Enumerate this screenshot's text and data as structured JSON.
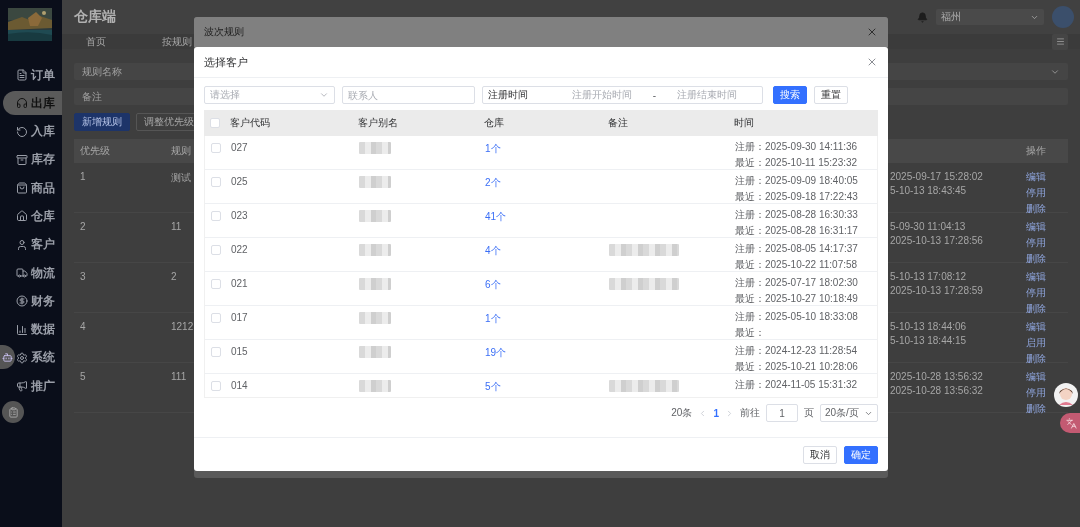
{
  "sidebar": {
    "items": [
      {
        "label": "订单",
        "selected": false
      },
      {
        "label": "出库",
        "selected": true
      },
      {
        "label": "入库",
        "selected": false
      },
      {
        "label": "库存",
        "selected": false
      },
      {
        "label": "商品",
        "selected": false
      },
      {
        "label": "仓库",
        "selected": false
      },
      {
        "label": "客户",
        "selected": false
      },
      {
        "label": "物流",
        "selected": false
      },
      {
        "label": "财务",
        "selected": false
      },
      {
        "label": "数据",
        "selected": false
      },
      {
        "label": "系统",
        "selected": false
      },
      {
        "label": "推广",
        "selected": false
      }
    ]
  },
  "header": {
    "title": "仓库端",
    "location_select": "福州"
  },
  "page_tabs": [
    {
      "label": "首页"
    },
    {
      "label": "按规则"
    }
  ],
  "rule_filters": {
    "name_placeholder": "规则名称",
    "note_placeholder": "备注"
  },
  "rule_actions": [
    {
      "label": "新增规则",
      "kind": "primary"
    },
    {
      "label": "调整优先级",
      "kind": "secondary"
    }
  ],
  "rules_table": {
    "columns": [
      "优先级",
      "规则",
      "操作"
    ],
    "rows": [
      {
        "priority": "1",
        "name": "测试",
        "time_1": "2025-09-17 15:28:02",
        "time_2": "5-10-13 18:43:45",
        "actions": [
          "编辑",
          "停用",
          "删除"
        ]
      },
      {
        "priority": "2",
        "name": "11",
        "time_1": "5-09-30 11:04:13",
        "time_2": "2025-10-13 17:28:56",
        "actions": [
          "编辑",
          "停用",
          "删除"
        ]
      },
      {
        "priority": "3",
        "name": "2",
        "time_1": "5-10-13 17:08:12",
        "time_2": "2025-10-13 17:28:59",
        "actions": [
          "编辑",
          "停用",
          "删除"
        ]
      },
      {
        "priority": "4",
        "name": "1212",
        "time_1": "5-10-13 18:44:06",
        "time_2": "5-10-13 18:44:15",
        "actions": [
          "编辑",
          "启用",
          "删除"
        ]
      },
      {
        "priority": "5",
        "name": "111",
        "time_1": "2025-10-28 13:56:32",
        "time_2": "2025-10-28 13:56:32",
        "actions": [
          "编辑",
          "停用",
          "删除"
        ]
      }
    ]
  },
  "back_dialog": {
    "title": "波次规则"
  },
  "dialog": {
    "title": "选择客户",
    "filters": {
      "select_placeholder": "请选择",
      "contact_placeholder": "联系人",
      "date_label": "注册时间",
      "start_placeholder": "注册开始时间",
      "separator": "-",
      "end_placeholder": "注册结束时间"
    },
    "search_button": "搜索",
    "reset_button": "重置",
    "table": {
      "select_all_checked": false,
      "columns": [
        "客户代码",
        "客户别名",
        "仓库",
        "备注",
        "时间"
      ],
      "rows": [
        {
          "checked": false,
          "code": "027",
          "name_blurred": true,
          "warehouses": "1个",
          "note_blurred": false,
          "registered": "注册：2025-09-30 14:11:36",
          "recent": "最近：2025-10-11 15:23:32"
        },
        {
          "checked": false,
          "code": "025",
          "name_blurred": true,
          "warehouses": "2个",
          "note_blurred": false,
          "registered": "注册：2025-09-09 18:40:05",
          "recent": "最近：2025-09-18 17:22:43"
        },
        {
          "checked": false,
          "code": "023",
          "name_blurred": true,
          "warehouses": "41个",
          "note_blurred": false,
          "registered": "注册：2025-08-28 16:30:33",
          "recent": "最近：2025-08-28 16:31:17"
        },
        {
          "checked": false,
          "code": "022",
          "name_blurred": true,
          "warehouses": "4个",
          "note_blurred": true,
          "registered": "注册：2025-08-05 14:17:37",
          "recent": "最近：2025-10-22 11:07:58"
        },
        {
          "checked": false,
          "code": "021",
          "name_blurred": true,
          "warehouses": "6个",
          "note_blurred": true,
          "registered": "注册：2025-07-17 18:02:30",
          "recent": "最近：2025-10-27 10:18:49"
        },
        {
          "checked": false,
          "code": "017",
          "name_blurred": true,
          "warehouses": "1个",
          "note_blurred": false,
          "registered": "注册：2025-05-10 18:33:08",
          "recent": "最近："
        },
        {
          "checked": false,
          "code": "015",
          "name_blurred": true,
          "warehouses": "19个",
          "note_blurred": false,
          "registered": "注册：2024-12-23 11:28:54",
          "recent": "最近：2025-10-21 10:28:06"
        },
        {
          "checked": false,
          "code": "014",
          "name_blurred": true,
          "warehouses": "5个",
          "note_blurred": true,
          "registered": "注册：2024-11-05 15:31:32"
        }
      ]
    },
    "pagination": {
      "total": "20条",
      "pages": [
        {
          "label": "1",
          "selected": true
        }
      ],
      "goto_label": "前往",
      "goto_value": "1",
      "page_unit": "页",
      "page_size": "20条/页"
    },
    "buttons": [
      {
        "label": "取消",
        "kind": "secondary"
      },
      {
        "label": "确定",
        "kind": "primary"
      }
    ]
  }
}
